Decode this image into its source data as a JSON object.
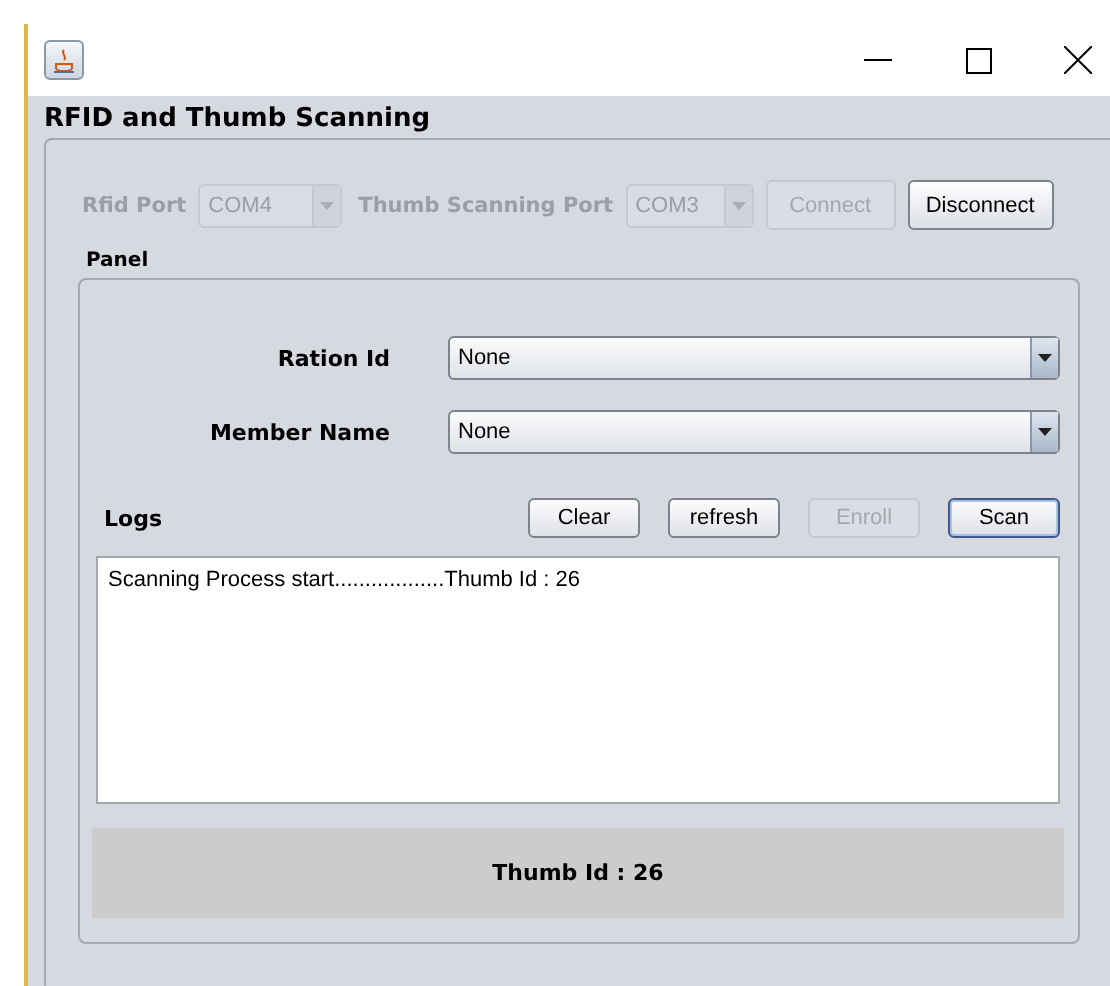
{
  "window": {
    "title_bar_buttons": [
      {
        "kind": "minimize"
      },
      {
        "kind": "maximize"
      },
      {
        "kind": "close"
      }
    ]
  },
  "section_title": "RFID and Thumb Scanning",
  "connection": {
    "ports": [
      {
        "label": "Rfid Port",
        "value": "COM4",
        "disabled": true
      },
      {
        "label": "Thumb Scanning Port",
        "value": "COM3",
        "disabled": true
      }
    ],
    "buttons": [
      {
        "label": "Connect",
        "disabled": true
      },
      {
        "label": "Disconnect",
        "disabled": false
      }
    ]
  },
  "panel": {
    "title": "Panel",
    "fields": [
      {
        "label": "Ration Id",
        "value": "None"
      },
      {
        "label": "Member Name",
        "value": "None"
      }
    ],
    "logs_label": "Logs",
    "log_buttons": [
      {
        "label": "Clear",
        "disabled": false
      },
      {
        "label": "refresh",
        "disabled": false
      },
      {
        "label": "Enroll",
        "disabled": true
      },
      {
        "label": "Scan",
        "disabled": false,
        "focused": true
      }
    ],
    "log_text": "Scanning Process start..................Thumb Id : 26",
    "status": "Thumb Id : 26"
  }
}
